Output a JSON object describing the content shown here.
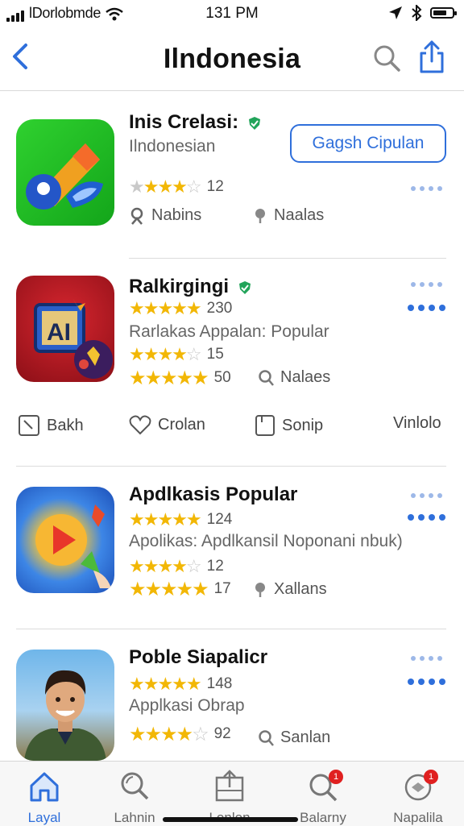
{
  "status": {
    "carrier": "lDorlobmde",
    "time": "131 PM"
  },
  "nav": {
    "title": "Ilndonesia"
  },
  "apps": [
    {
      "name": "Inis Crelasi:",
      "subtitle": "Ilndonesian",
      "rating_count": "12",
      "rating": 3.5,
      "button": "Gagsh Cipulan",
      "meta_left": "Nabins",
      "meta_right": "Naalas"
    },
    {
      "name": "Ralkirgingi",
      "rating_line1_count": "230",
      "rating_line1": 4.5,
      "description": "Rarlakas Appalan: Popular",
      "rating_line2_count": "15",
      "rating_line2": 4.5,
      "rating_line3_count": "50",
      "rating_line3": 4.5,
      "meta_right": "Nalaes"
    },
    {
      "name": "Apdlkasis Popular",
      "rating_line1_count": "124",
      "rating_line1": 4.5,
      "description": "Apolikas: Apdlkansil Noponani nbuk)",
      "rating_line2_count": "12",
      "rating_line2": 4.5,
      "rating_line3_count": "17",
      "rating_line3": 4.5,
      "meta_right": "Xallans"
    },
    {
      "name": "Poble Siapalicr",
      "rating_line1_count": "148",
      "rating_line1": 5,
      "description": "Applkasi Obrap",
      "rating_line2_count": "92",
      "rating_line2": 4.5,
      "meta_right": "Sanlan"
    }
  ],
  "actions": {
    "a1": "Bakh",
    "a2": "Crolan",
    "a3": "Sonip",
    "a4": "Vinlolo"
  },
  "tabs": [
    {
      "label": "Layal",
      "icon": "home-icon"
    },
    {
      "label": "Lahnin",
      "icon": "search-icon"
    },
    {
      "label": "Lonlon",
      "icon": "inbox-icon"
    },
    {
      "label": "Balarny",
      "icon": "search-badge-icon",
      "badge": "1"
    },
    {
      "label": "Napalila",
      "icon": "chat-badge-icon",
      "badge": "1"
    }
  ],
  "colors": {
    "accent": "#2f6fdb",
    "star": "#f2b705",
    "verified": "#22a45a"
  }
}
